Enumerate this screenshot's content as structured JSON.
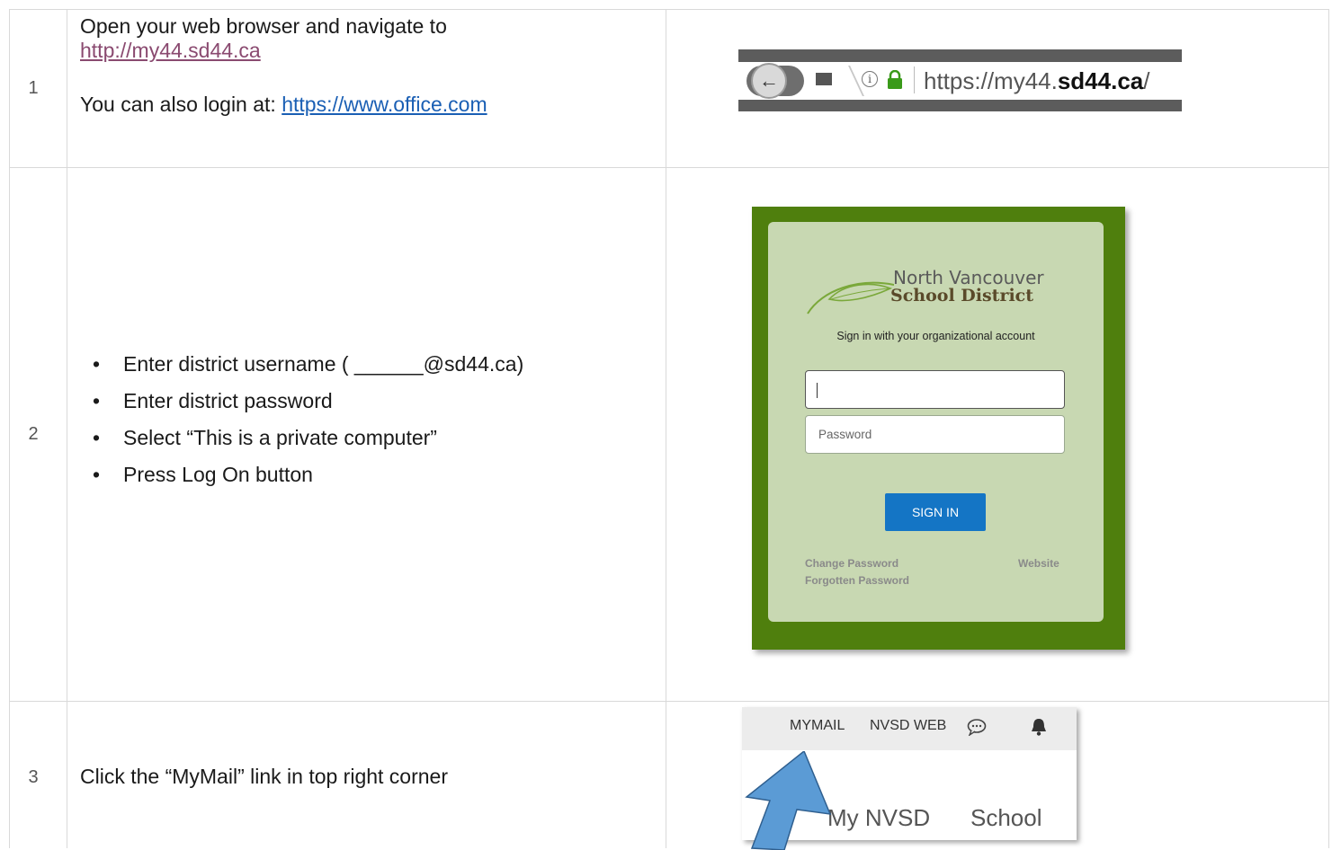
{
  "rows": [
    {
      "number": "1",
      "line1": "Open your web browser and navigate to",
      "link1": "http://my44.sd44.ca",
      "line2_prefix": "You can also login at: ",
      "link2": "https://www.office.com"
    },
    {
      "number": "2",
      "bullets": [
        "Enter district username ( ______@sd44.ca)",
        "Enter district password",
        "Select “This is a private computer”",
        "Press Log On button"
      ]
    },
    {
      "number": "3",
      "text": "Click the “MyMail” link in top right corner"
    }
  ],
  "browser_bar": {
    "url_prefix": "https://my44.",
    "url_domain": "sd44.ca",
    "url_suffix": "/"
  },
  "login": {
    "logo_line1": "North Vancouver",
    "logo_line2": "School District",
    "prompt": "Sign in with your organizational account",
    "password_placeholder": "Password",
    "signin_button": "SIGN IN",
    "change_password": "Change Password",
    "forgotten_password": "Forgotten Password",
    "website": "Website"
  },
  "mymail": {
    "nav_items": [
      "MYMAIL",
      "NVSD WEB"
    ],
    "tabs": [
      "My NVSD",
      "School"
    ]
  },
  "colors": {
    "login_bg": "#4f7f0d",
    "card_bg": "#c8d8b2",
    "signin_button": "#1475c5",
    "arrow": "#5b9bd5"
  }
}
